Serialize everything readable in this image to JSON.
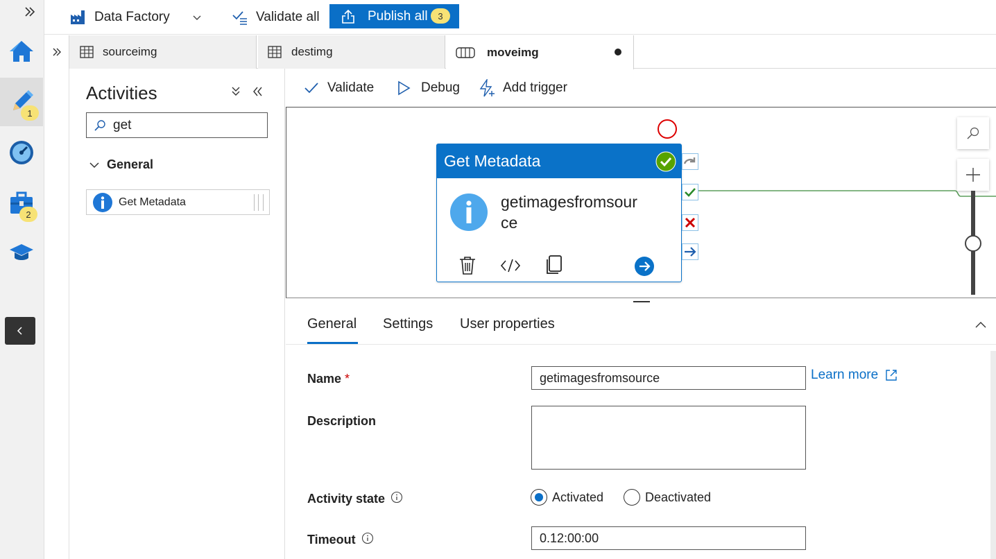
{
  "rail": {
    "badge_author": "1",
    "badge_manage": "2"
  },
  "topbar": {
    "factory_label": "Data Factory",
    "validate_all": "Validate all",
    "publish_all": "Publish all",
    "publish_count": "3"
  },
  "tabs": [
    {
      "label": "sourceimg",
      "icon": "table-icon"
    },
    {
      "label": "destimg",
      "icon": "table-icon"
    },
    {
      "label": "moveimg",
      "icon": "pipeline-icon"
    }
  ],
  "activities": {
    "title": "Activities",
    "search_value": "get",
    "group": "General",
    "item": "Get Metadata"
  },
  "toolbar": {
    "validate": "Validate",
    "debug": "Debug",
    "add_trigger": "Add trigger"
  },
  "node": {
    "title": "Get Metadata",
    "name_line1": "getimagesfromsour",
    "name_line2": "ce"
  },
  "props": {
    "tabs": [
      "General",
      "Settings",
      "User properties"
    ],
    "name_label": "Name",
    "required_mark": "*",
    "name_value": "getimagesfromsource",
    "learn_more": "Learn more",
    "description_label": "Description",
    "description_value": "",
    "state_label": "Activity state",
    "state_options": [
      "Activated",
      "Deactivated"
    ],
    "state_selected": "Activated",
    "timeout_label": "Timeout",
    "timeout_value": "0.12:00:00"
  },
  "colors": {
    "accent": "#0a6fc7",
    "node_header": "#0a72c8",
    "success": "#57a300",
    "fail": "#c00",
    "badge": "#f7e275"
  }
}
